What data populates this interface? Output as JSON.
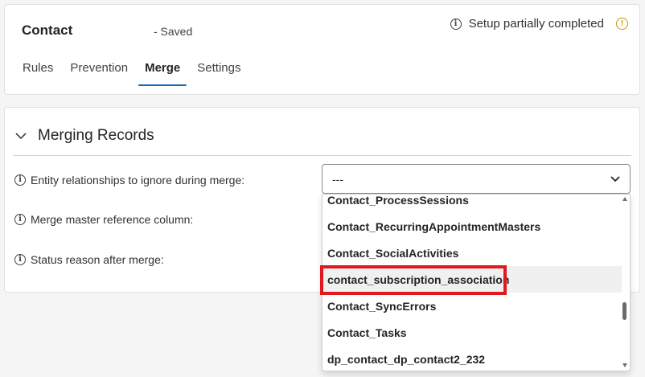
{
  "header": {
    "entity_title": "Contact",
    "saved_status": "- Saved",
    "setup_status": "Setup partially completed"
  },
  "tabs": [
    {
      "label": "Rules",
      "active": false
    },
    {
      "label": "Prevention",
      "active": false
    },
    {
      "label": "Merge",
      "active": true
    },
    {
      "label": "Settings",
      "active": false
    }
  ],
  "section": {
    "title": "Merging Records",
    "fields": [
      {
        "label": "Entity relationships to ignore during merge:"
      },
      {
        "label": "Merge master reference column:"
      },
      {
        "label": "Status reason after merge:"
      }
    ]
  },
  "select": {
    "value": "---"
  },
  "dropdown": {
    "options": [
      "Contact_ProcessSessions",
      "Contact_RecurringAppointmentMasters",
      "Contact_SocialActivities",
      "contact_subscription_association",
      "Contact_SyncErrors",
      "Contact_Tasks",
      "dp_contact_dp_contact2_232"
    ],
    "hovered_option": "contact_subscription_association",
    "highlighted_option": "contact_subscription_association"
  },
  "colors": {
    "accent": "#0f6cbd",
    "warning": "#c19c00",
    "highlight": "#e0191e"
  },
  "icons": [
    "info-icon",
    "warning-icon",
    "chevron-down-icon"
  ]
}
